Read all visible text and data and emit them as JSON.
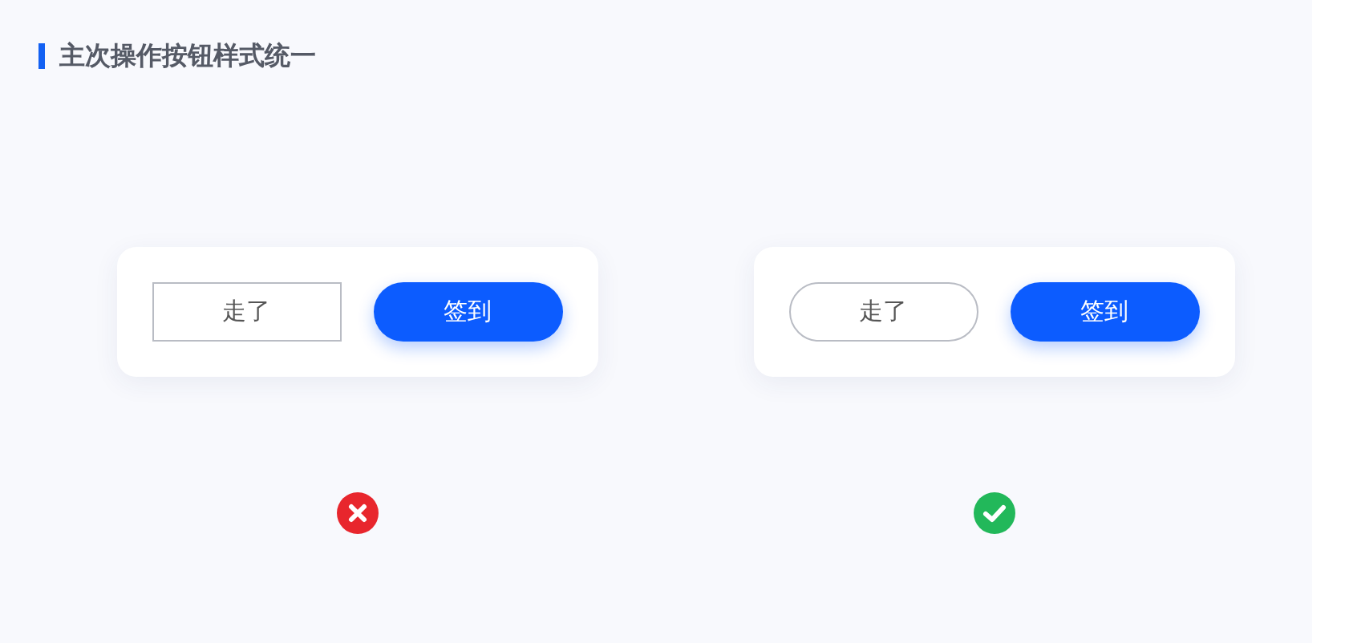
{
  "title": "主次操作按钮样式统一",
  "examples": [
    {
      "secondary": {
        "label": "走了",
        "kind": "rect"
      },
      "primary": {
        "label": "签到"
      },
      "correct": false
    },
    {
      "secondary": {
        "label": "走了",
        "kind": "pill"
      },
      "primary": {
        "label": "签到"
      },
      "correct": true
    }
  ]
}
